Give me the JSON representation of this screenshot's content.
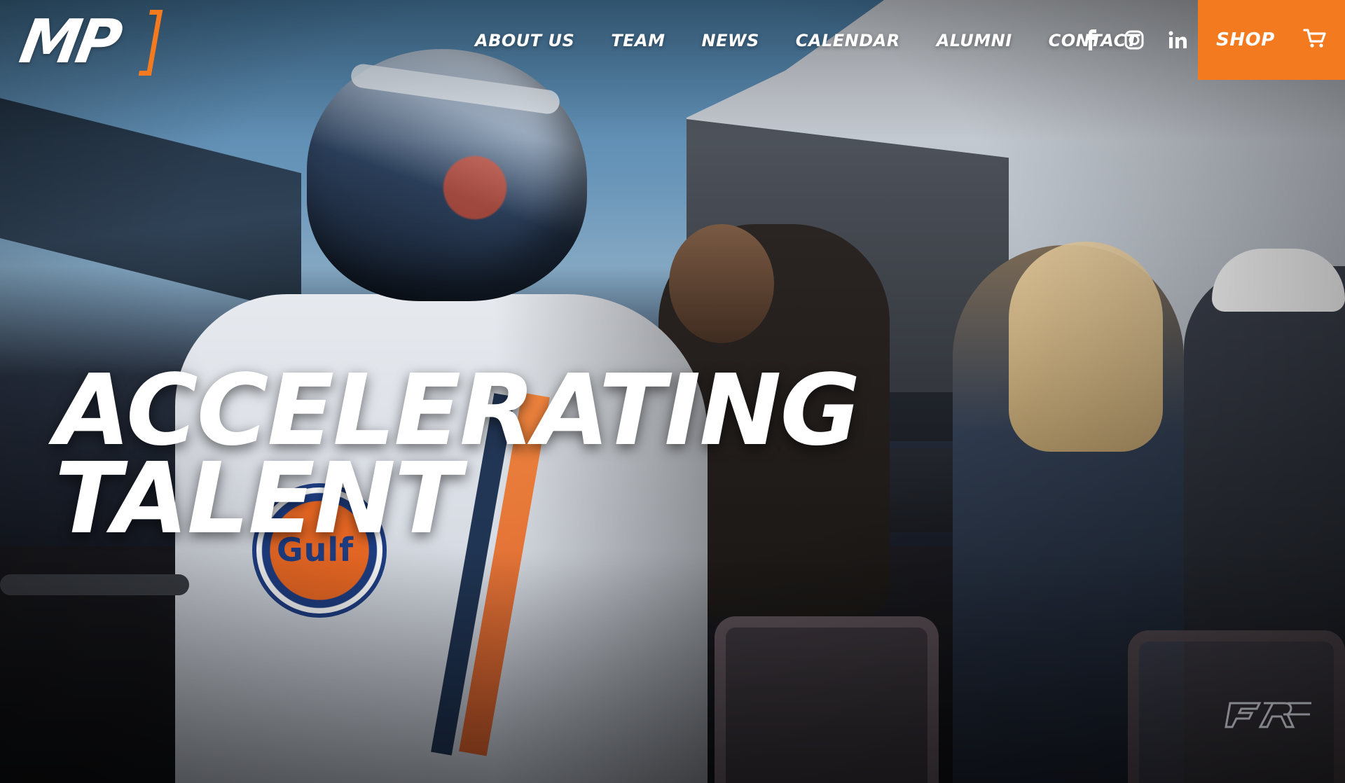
{
  "header": {
    "logo": {
      "text": "MP",
      "accent_color": "#f47a20"
    },
    "nav": {
      "items": [
        {
          "label": "ABOUT US"
        },
        {
          "label": "TEAM"
        },
        {
          "label": "NEWS"
        },
        {
          "label": "CALENDAR"
        },
        {
          "label": "ALUMNI"
        },
        {
          "label": "CONTACT"
        }
      ]
    },
    "social": [
      {
        "icon": "facebook-icon"
      },
      {
        "icon": "instagram-icon"
      },
      {
        "icon": "linkedin-icon"
      }
    ],
    "shop": {
      "label": "SHOP",
      "icon": "cart-icon",
      "background": "#f47a20"
    }
  },
  "hero": {
    "title_line_1": "ACCELERATING",
    "title_line_2": "TALENT",
    "badge_text": "Gulf"
  },
  "colors": {
    "text": "#ffffff",
    "accent": "#f47a20"
  }
}
